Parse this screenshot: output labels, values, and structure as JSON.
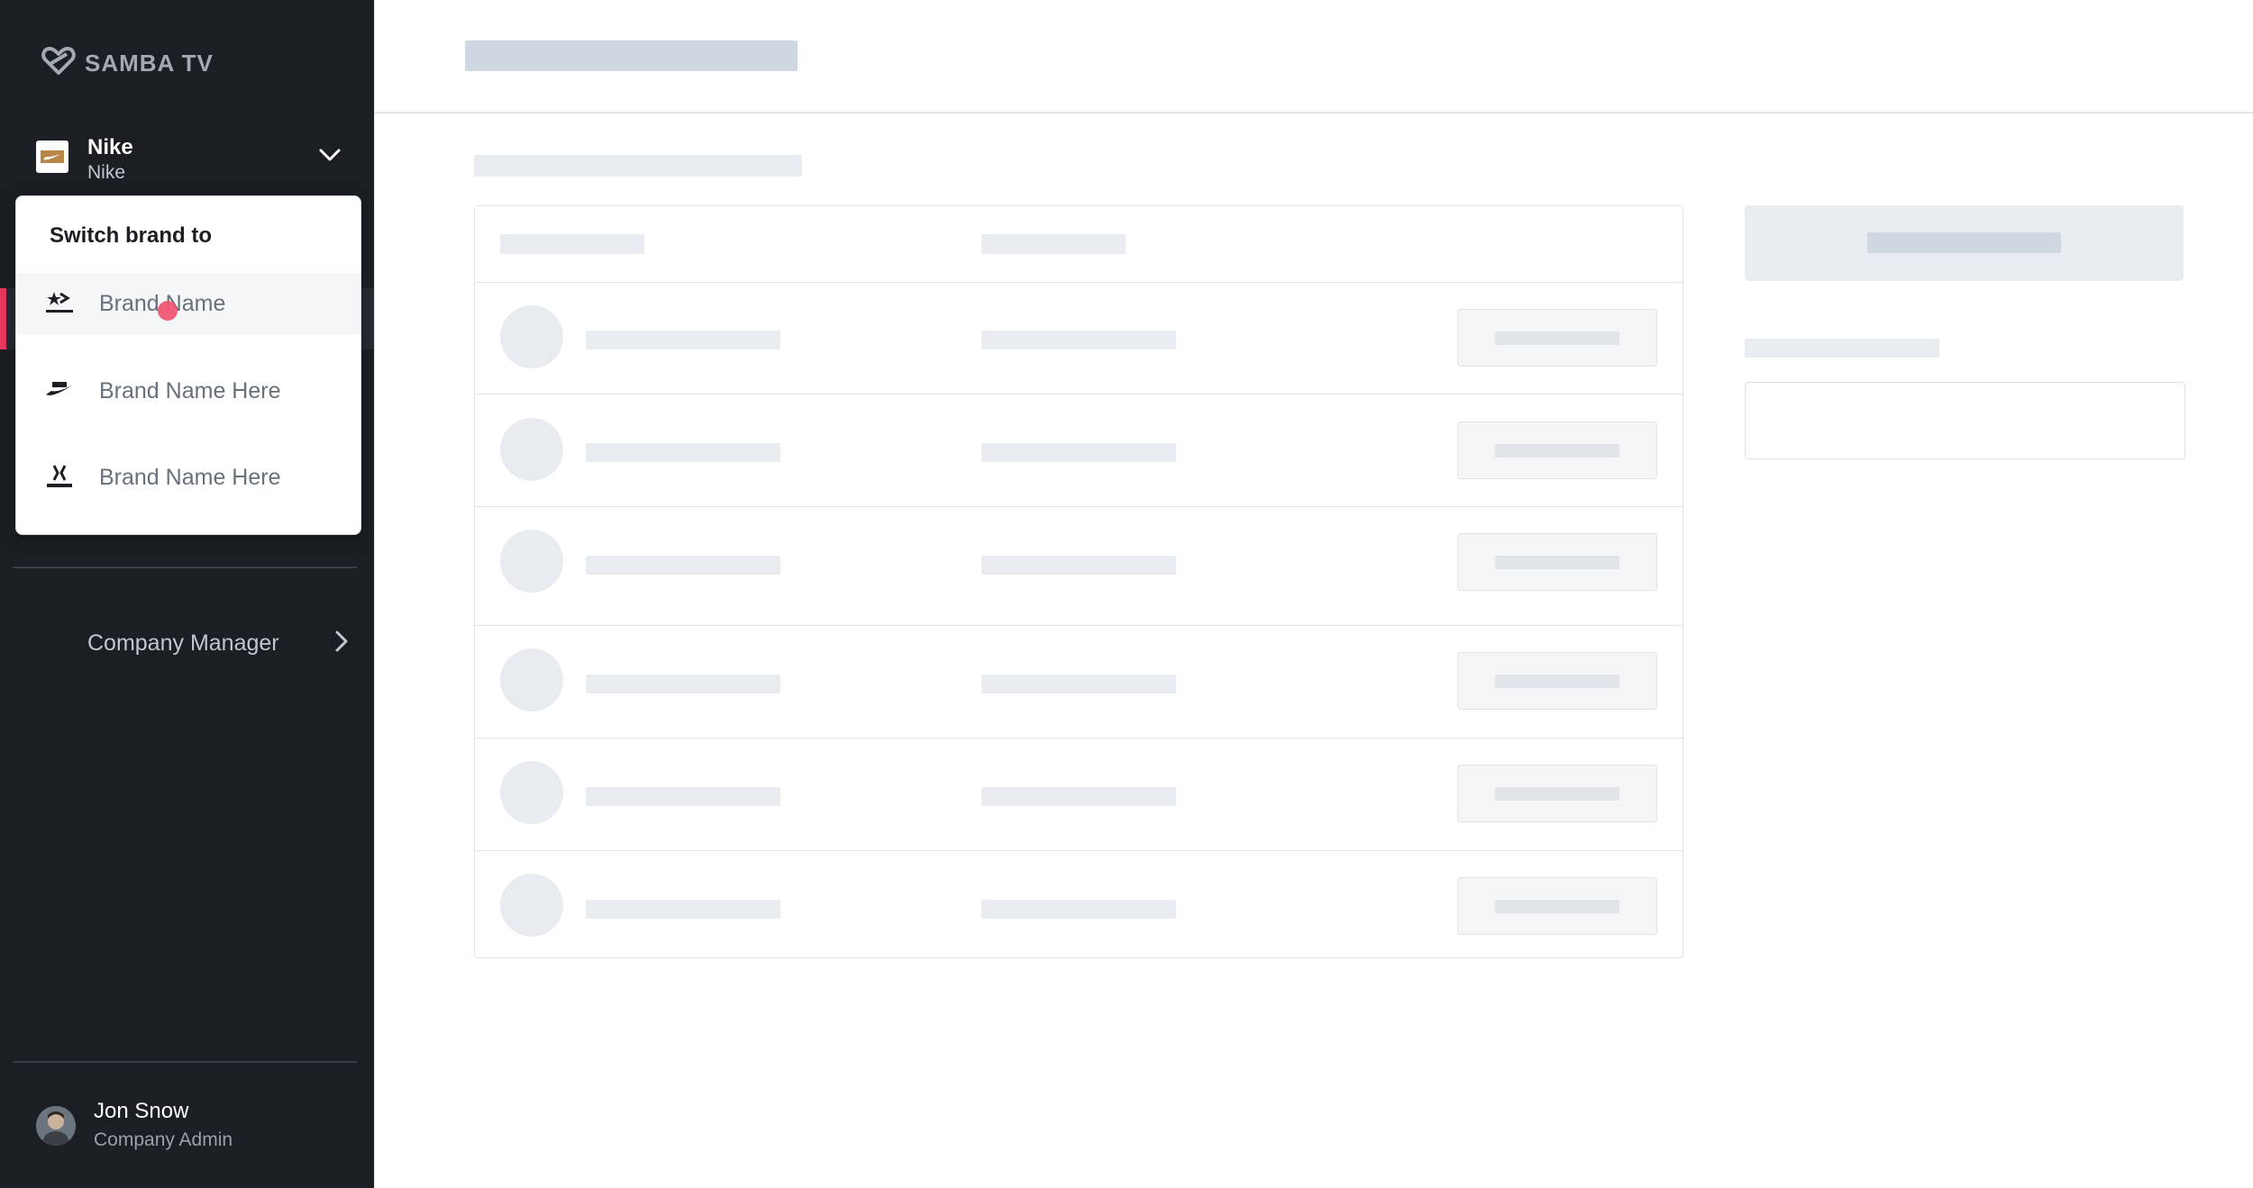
{
  "app": {
    "logo_text": "SAMBA TV"
  },
  "brand_selector": {
    "name": "Nike",
    "sub": "Nike"
  },
  "dropdown": {
    "title": "Switch brand to",
    "items": [
      {
        "label": "Brand Name",
        "logo": "converse-logo"
      },
      {
        "label": "Brand Name Here",
        "logo": "nike-sb-logo"
      },
      {
        "label": "Brand Name Here",
        "logo": "hurley-logo"
      }
    ]
  },
  "nav": {
    "company_manager": "Company Manager"
  },
  "user": {
    "name": "Jon Snow",
    "role": "Company Admin"
  },
  "colors": {
    "sidebar": "#1b1f23",
    "accent": "#e8365c",
    "skeleton": "#e8ecf0"
  },
  "main": {
    "state": "loading-skeleton",
    "rows": 6
  }
}
